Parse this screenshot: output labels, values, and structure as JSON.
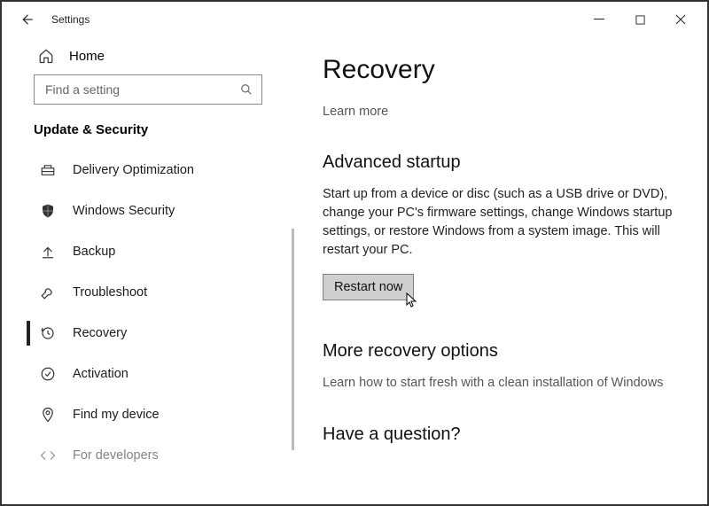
{
  "titlebar": {
    "title": "Settings"
  },
  "sidebar": {
    "home_label": "Home",
    "search_placeholder": "Find a setting",
    "category": "Update & Security",
    "items": [
      {
        "label": "Delivery Optimization",
        "icon": "delivery"
      },
      {
        "label": "Windows Security",
        "icon": "shield"
      },
      {
        "label": "Backup",
        "icon": "backup"
      },
      {
        "label": "Troubleshoot",
        "icon": "wrench"
      },
      {
        "label": "Recovery",
        "icon": "recovery"
      },
      {
        "label": "Activation",
        "icon": "activation"
      },
      {
        "label": "Find my device",
        "icon": "location"
      },
      {
        "label": "For developers",
        "icon": "devs"
      }
    ]
  },
  "main": {
    "title": "Recovery",
    "learn_more": "Learn more",
    "advanced_startup": {
      "heading": "Advanced startup",
      "body": "Start up from a device or disc (such as a USB drive or DVD), change your PC's firmware settings, change Windows startup settings, or restore Windows from a system image. This will restart your PC.",
      "button": "Restart now"
    },
    "more_options": {
      "heading": "More recovery options",
      "body": "Learn how to start fresh with a clean installation of Windows"
    },
    "question_heading": "Have a question?"
  }
}
